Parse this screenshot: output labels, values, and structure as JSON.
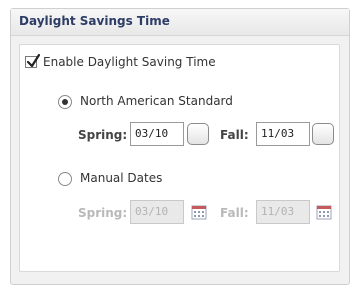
{
  "panel": {
    "title": "Daylight Savings Time"
  },
  "dst": {
    "enable_label": "Enable Daylight Saving Time",
    "enabled": true,
    "mode": "north_american",
    "north_american": {
      "label": "North American Standard",
      "spring_label": "Spring:",
      "spring_value": "03/10",
      "fall_label": "Fall:",
      "fall_value": "11/03"
    },
    "manual": {
      "label": "Manual Dates",
      "spring_label": "Spring:",
      "spring_value": "03/10",
      "fall_label": "Fall:",
      "fall_value": "11/03",
      "disabled": true
    }
  },
  "icons": {
    "checkbox_check": "check-icon",
    "calendar": "calendar-icon"
  },
  "colors": {
    "title": "#2e3d66",
    "panel_bg": "#f1f1f1",
    "disabled_text": "#b9b9b9"
  }
}
